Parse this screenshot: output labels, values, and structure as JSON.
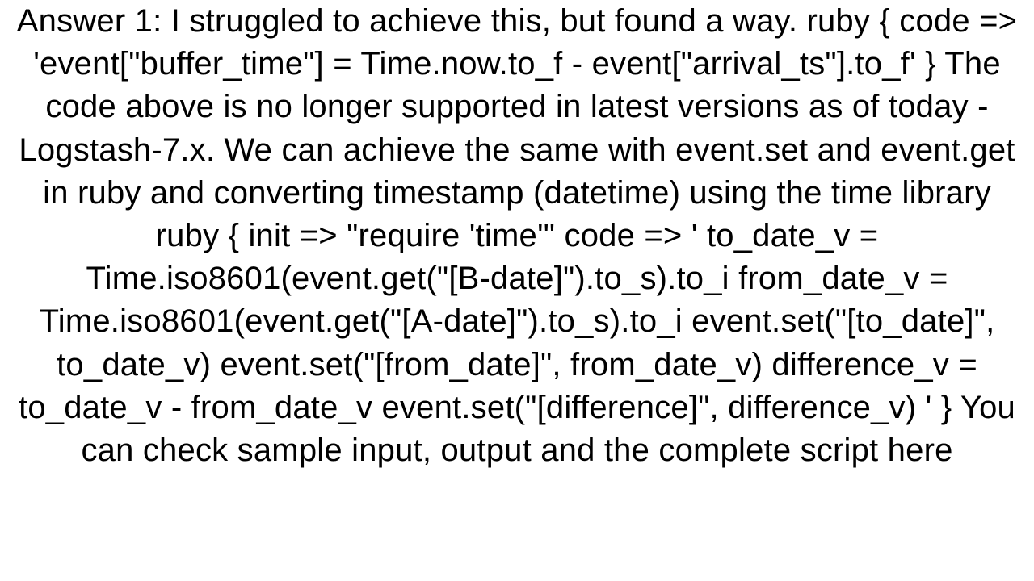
{
  "answer": {
    "text": "Answer 1: I struggled to achieve this, but found a way. ruby {   code => 'event[\"buffer_time\"] = Time.now.to_f - event[\"arrival_ts\"].to_f' }  The code above is no longer supported in latest versions as of today - Logstash-7.x. We can achieve the same with event.set and event.get in ruby and converting timestamp (datetime) using the time library ruby {      init => \"require 'time'\"      code => '      to_date_v   = Time.iso8601(event.get(\"[B-date]\").to_s).to_i      from_date_v = Time.iso8601(event.get(\"[A-date]\").to_s).to_i      event.set(\"[to_date]\", to_date_v)      event.set(\"[from_date]\", from_date_v)      difference_v = to_date_v - from_date_v      event.set(\"[difference]\", difference_v)      '      }   You can check sample input, output and the complete script here"
  }
}
